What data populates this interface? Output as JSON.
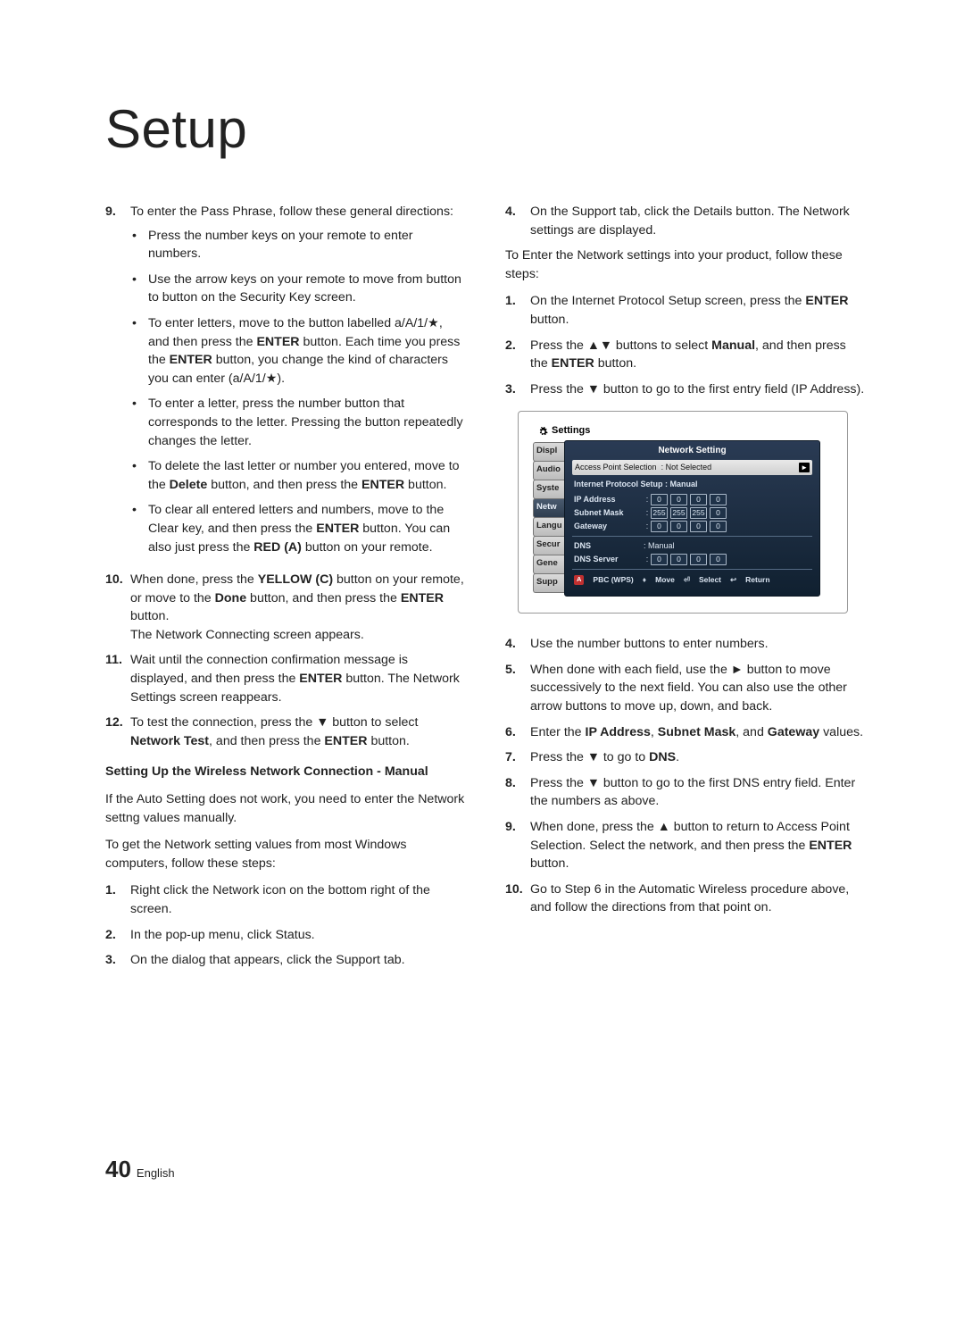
{
  "title": "Setup",
  "footer": {
    "page": "40",
    "lang": "English"
  },
  "left": {
    "items": [
      {
        "n": "9.",
        "text": "To enter the Pass Phrase, follow these general directions:",
        "bullets": [
          "Press the number keys on your remote to enter numbers.",
          "Use the arrow keys on your remote to move from button to button on the Security Key screen.",
          "To enter letters, move to the button labelled a/A/1/★, and then press the ENTER button. Each time you press the ENTER button, you change the kind of characters you can enter (a/A/1/★).",
          "To enter a letter, press the number button that corresponds to the letter. Pressing the button repeatedly changes the letter.",
          "To delete the last letter or number you entered, move to the Delete button, and then press the ENTER button.",
          "To clear all entered letters and numbers, move to the Clear key, and then press the ENTER button. You can also just press the RED (A) button on your remote."
        ]
      },
      {
        "n": "10.",
        "text": "When done, press the YELLOW (C) button on your remote, or move to the Done button, and then press the ENTER button. The Network Connecting screen appears."
      },
      {
        "n": "11.",
        "text": "Wait until the connection confirmation message is displayed, and then press the ENTER button. The Network Settings screen reappears."
      },
      {
        "n": "12.",
        "text": "To test the connection, press the ▼ button to select Network Test, and then press the ENTER button."
      }
    ],
    "subhead": "Setting Up the Wireless Network Connection - Manual",
    "para1": "If the Auto Setting does not work, you need to enter the Network settng values manually.",
    "para2": "To get the Network setting values from most Windows computers, follow these steps:",
    "steps": [
      {
        "n": "1.",
        "text": "Right click the Network icon on the bottom right of the screen."
      },
      {
        "n": "2.",
        "text": "In the pop-up menu, click Status."
      },
      {
        "n": "3.",
        "text": "On the dialog that appears, click the Support tab."
      }
    ]
  },
  "right": {
    "cont": {
      "n": "4.",
      "text": "On the Support tab, click the Details button. The Network settings are displayed."
    },
    "lead": "To Enter the Network settings into your product, follow these steps:",
    "steps_a": [
      {
        "n": "1.",
        "text": "On the Internet Protocol Setup screen, press the ENTER button."
      },
      {
        "n": "2.",
        "text": "Press the ▲▼ buttons to select Manual, and then press the ENTER button."
      },
      {
        "n": "3.",
        "text": "Press the ▼ button to go to the first entry field (IP Address)."
      }
    ],
    "steps_b": [
      {
        "n": "4.",
        "text": "Use the number buttons to enter numbers."
      },
      {
        "n": "5.",
        "text": "When done with each field, use the ► button to move successively to the next field. You can also use the other arrow buttons to move up, down, and back."
      },
      {
        "n": "6.",
        "text": "Enter the IP Address, Subnet Mask, and Gateway values."
      },
      {
        "n": "7.",
        "text": "Press the ▼ to go to DNS."
      },
      {
        "n": "8.",
        "text": "Press the ▼ button to go to the first DNS entry field. Enter the numbers as above."
      },
      {
        "n": "9.",
        "text": "When done, press the ▲ button to return to Access Point Selection. Select the network, and then press the ENTER button."
      },
      {
        "n": "10.",
        "text": "Go to Step 6 in the Automatic Wireless procedure above, and follow the directions from that point on."
      }
    ]
  },
  "shot": {
    "bar": "Settings",
    "tabs": [
      "Displ",
      "Audio",
      "Syste",
      "Netw",
      "Langu",
      "Secur",
      "Gene",
      "Supp"
    ],
    "activeTab": 3,
    "title": "Network Setting",
    "aps_label": "Access Point Selection",
    "aps_value": ": Not Selected",
    "ips_label": "Internet Protocol Setup",
    "ips_value": ": Manual",
    "ip_label": "IP Address",
    "ip": [
      "0",
      "0",
      "0",
      "0"
    ],
    "subnet_label": "Subnet Mask",
    "subnet": [
      "255",
      "255",
      "255",
      "0"
    ],
    "gw_label": "Gateway",
    "gw": [
      "0",
      "0",
      "0",
      "0"
    ],
    "dns_label": "DNS",
    "dns_value": ": Manual",
    "dnssrv_label": "DNS Server",
    "dnssrv": [
      "0",
      "0",
      "0",
      "0"
    ],
    "foot_a": "A",
    "foot_pbc": "PBC (WPS)",
    "foot_move": "Move",
    "foot_select": "Select",
    "foot_return": "Return"
  }
}
